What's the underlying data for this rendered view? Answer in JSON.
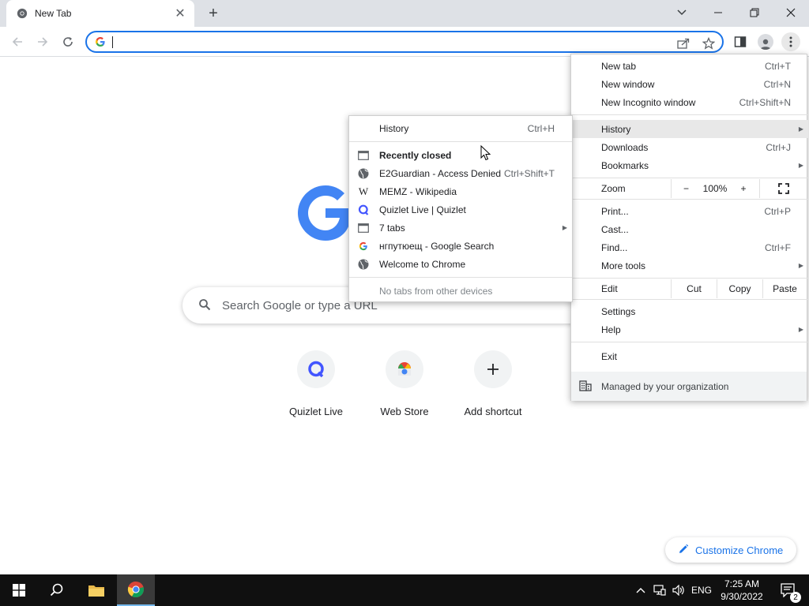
{
  "tab": {
    "title": "New Tab",
    "close": "✕"
  },
  "window": {
    "new_tab_symbol": "+"
  },
  "omnibox": {
    "value": "",
    "placeholder": ""
  },
  "ntp": {
    "search_placeholder": "Search Google or type a URL",
    "shortcuts": [
      {
        "label": "Quizlet Live"
      },
      {
        "label": "Web Store"
      },
      {
        "label": "Add shortcut"
      }
    ],
    "customize_label": "Customize Chrome"
  },
  "menu": {
    "new_tab": {
      "label": "New tab",
      "accel": "Ctrl+T"
    },
    "new_window": {
      "label": "New window",
      "accel": "Ctrl+N"
    },
    "new_incognito": {
      "label": "New Incognito window",
      "accel": "Ctrl+Shift+N"
    },
    "history": {
      "label": "History"
    },
    "downloads": {
      "label": "Downloads",
      "accel": "Ctrl+J"
    },
    "bookmarks": {
      "label": "Bookmarks"
    },
    "zoom": {
      "label": "Zoom",
      "minus": "−",
      "value": "100%",
      "plus": "+"
    },
    "print": {
      "label": "Print...",
      "accel": "Ctrl+P"
    },
    "cast": {
      "label": "Cast..."
    },
    "find": {
      "label": "Find...",
      "accel": "Ctrl+F"
    },
    "more_tools": {
      "label": "More tools"
    },
    "edit": {
      "label": "Edit",
      "cut": "Cut",
      "copy": "Copy",
      "paste": "Paste"
    },
    "settings": {
      "label": "Settings"
    },
    "help": {
      "label": "Help"
    },
    "exit": {
      "label": "Exit"
    },
    "managed": {
      "label": "Managed by your organization"
    }
  },
  "history_menu": {
    "history": {
      "label": "History",
      "accel": "Ctrl+H"
    },
    "recently_closed": {
      "label": "Recently closed"
    },
    "items": [
      {
        "label": "E2Guardian - Access Denied",
        "accel": "Ctrl+Shift+T",
        "icon": "globe-icon"
      },
      {
        "label": "MEMZ - Wikipedia",
        "accel": "",
        "icon": "wikipedia-icon"
      },
      {
        "label": "Quizlet Live | Quizlet",
        "accel": "",
        "icon": "quizlet-icon"
      },
      {
        "label": "7 tabs",
        "accel": "",
        "icon": "window-icon"
      },
      {
        "label": "нгпутюещ - Google Search",
        "accel": "",
        "icon": "google-icon"
      },
      {
        "label": "Welcome to Chrome",
        "accel": "",
        "icon": "globe-icon"
      }
    ],
    "no_tabs": {
      "label": "No tabs from other devices"
    }
  },
  "taskbar": {
    "language": "ENG",
    "time": "7:25 AM",
    "date": "9/30/2022",
    "notifications": "2"
  }
}
